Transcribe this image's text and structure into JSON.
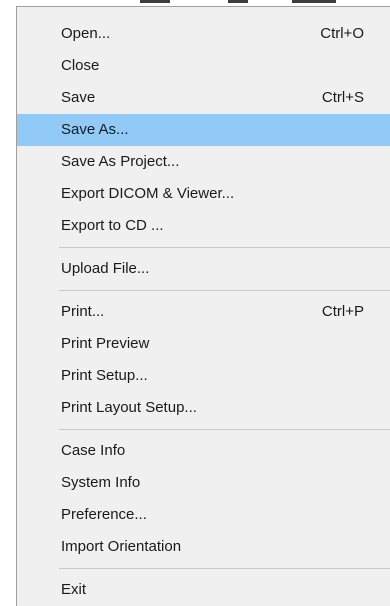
{
  "menu": {
    "items": [
      {
        "label": "Open...",
        "shortcut": "Ctrl+O"
      },
      {
        "label": "Close",
        "shortcut": ""
      },
      {
        "label": "Save",
        "shortcut": "Ctrl+S"
      },
      {
        "label": "Save As...",
        "shortcut": "",
        "highlighted": true
      },
      {
        "label": "Save As Project...",
        "shortcut": ""
      },
      {
        "label": "Export DICOM & Viewer...",
        "shortcut": ""
      },
      {
        "label": "Export to CD ...",
        "shortcut": ""
      },
      {
        "label": "Upload File...",
        "shortcut": ""
      },
      {
        "label": "Print...",
        "shortcut": "Ctrl+P"
      },
      {
        "label": "Print Preview",
        "shortcut": ""
      },
      {
        "label": "Print Setup...",
        "shortcut": ""
      },
      {
        "label": "Print Layout Setup...",
        "shortcut": ""
      },
      {
        "label": "Case Info",
        "shortcut": ""
      },
      {
        "label": "System Info",
        "shortcut": ""
      },
      {
        "label": "Preference...",
        "shortcut": ""
      },
      {
        "label": "Import Orientation",
        "shortcut": ""
      },
      {
        "label": "Exit",
        "shortcut": ""
      }
    ]
  },
  "colors": {
    "menu_background": "#f0f0f0",
    "highlight": "#91c9f7",
    "separator": "#c8c8c8",
    "text": "#1a1a1a"
  }
}
